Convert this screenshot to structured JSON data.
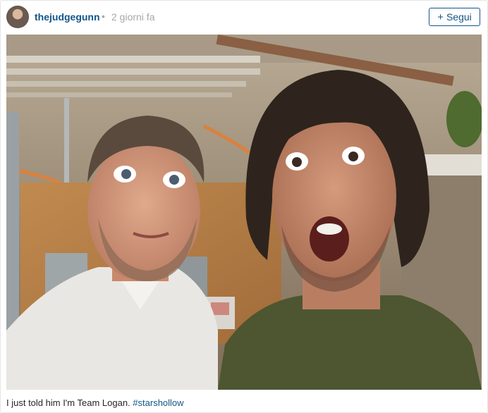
{
  "post": {
    "username": "thejudgegunn",
    "separator": "•",
    "timestamp": "2 giorni fa",
    "follow_icon": "+",
    "follow_label": "Segui",
    "caption_text": "I just told him I'm Team Logan.",
    "caption_hashtag": "#starshollow",
    "photo_icon": "selfie-photo"
  }
}
